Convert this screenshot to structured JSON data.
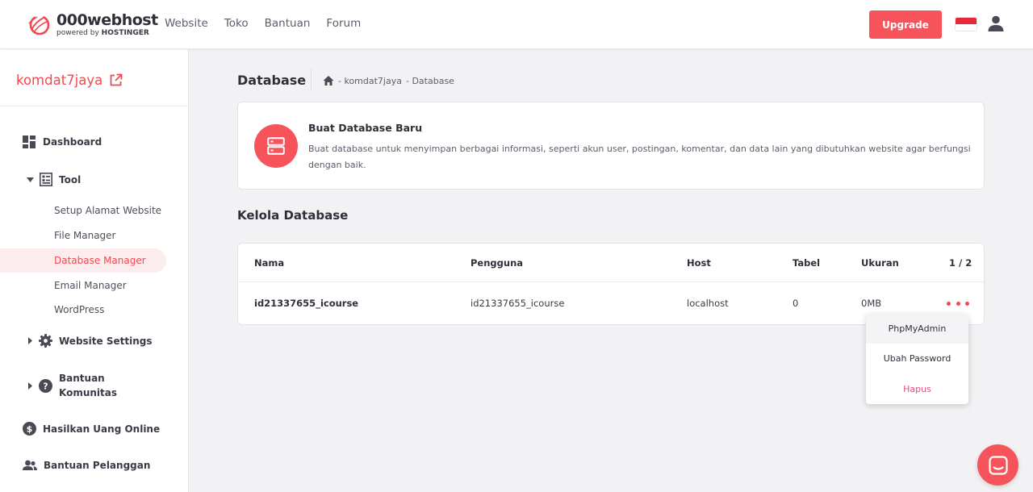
{
  "brand": {
    "name": "000webhost",
    "sub_prefix": "powered by",
    "sub_brand": "HOSTINGER"
  },
  "nav": {
    "items": [
      "Website",
      "Toko",
      "Bantuan",
      "Forum"
    ]
  },
  "header": {
    "upgrade_label": "Upgrade",
    "flag": "indonesia-flag",
    "user_icon": "user-icon"
  },
  "sidebar": {
    "site_name": "komdat7jaya",
    "dashboard": "Dashboard",
    "tool": "Tool",
    "tool_items": [
      "Setup Alamat Website",
      "File Manager",
      "Database Manager",
      "Email Manager",
      "WordPress"
    ],
    "active_item": "Database Manager",
    "website_settings": "Website Settings",
    "bantuan_komunitas_1": "Bantuan",
    "bantuan_komunitas_2": "Komunitas",
    "hasilkan": "Hasilkan Uang Online",
    "bantuan_pelanggan": "Bantuan Pelanggan"
  },
  "page": {
    "title": "Database",
    "breadcrumb": [
      "- komdat7jaya",
      "- Database"
    ]
  },
  "create_card": {
    "title": "Buat Database Baru",
    "description": "Buat database untuk menyimpan berbagai informasi, seperti akun user, postingan, komentar, dan data lain yang dibutuhkan website agar berfungsi dengan baik."
  },
  "manage": {
    "title": "Kelola Database",
    "columns": [
      "Nama",
      "Pengguna",
      "Host",
      "Tabel",
      "Ukuran"
    ],
    "pagination": "1 / 2",
    "rows": [
      {
        "nama": "id21337655_icourse",
        "pengguna": "id21337655_icourse",
        "host": "localhost",
        "tabel": "0",
        "ukuran": "0MB"
      }
    ]
  },
  "dropdown": {
    "items": [
      "PhpMyAdmin",
      "Ubah Password",
      "Hapus"
    ]
  },
  "colors": {
    "accent": "#f7535b",
    "accent_text": "#f2484f",
    "danger_text": "#e84a8a",
    "active_bg": "#fdeced"
  }
}
